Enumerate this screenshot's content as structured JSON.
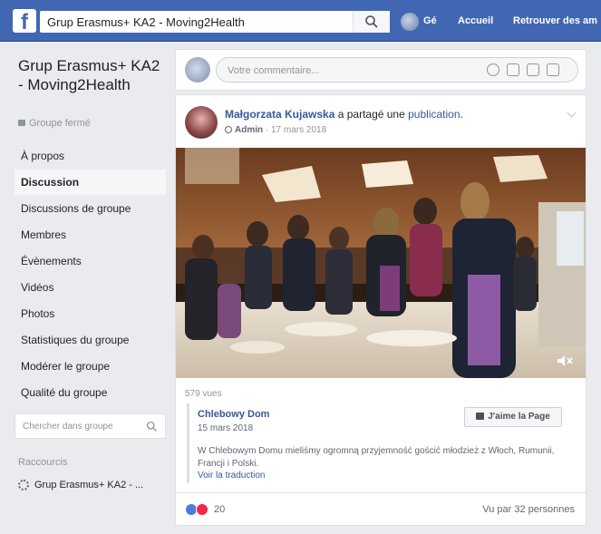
{
  "topbar": {
    "logo": "f",
    "search_value": "Grup Erasmus+ KA2 - Moving2Health",
    "user_name": "Gé",
    "nav_home": "Accueil",
    "nav_find": "Retrouver des am"
  },
  "sidebar": {
    "group_title": "Grup Erasmus+ KA2 - Moving2Health",
    "privacy": "Groupe fermé",
    "items": [
      {
        "label": "À propos"
      },
      {
        "label": "Discussion"
      },
      {
        "label": "Discussions de groupe"
      },
      {
        "label": "Membres"
      },
      {
        "label": "Évènements"
      },
      {
        "label": "Vidéos"
      },
      {
        "label": "Photos"
      },
      {
        "label": "Statistiques du groupe"
      },
      {
        "label": "Modérer le groupe"
      },
      {
        "label": "Qualité du groupe"
      }
    ],
    "search_placeholder": "Chercher dans groupe",
    "shortcuts_title": "Raccourcis",
    "shortcut_label": "Grup Erasmus+ KA2 - ..."
  },
  "composer": {
    "placeholder": "Votre commentaire..."
  },
  "post": {
    "author": "Małgorzata Kujawska",
    "action": "a partagé une",
    "object": "publication",
    "role": "Admin",
    "date": "17 mars 2018",
    "views": "579 vues",
    "shared_page": "Chlebowy Dom",
    "shared_date": "15 mars 2018",
    "like_page": "J'aime la Page",
    "text": "W Chlebowym Domu mieliśmy ogromną przyjemność gościć młodzież z Włoch, Rumunii, Francji i Polski.",
    "translate": "Voir la traduction",
    "reaction_count": "20",
    "seen_by": "Vu par 32 personnes"
  }
}
